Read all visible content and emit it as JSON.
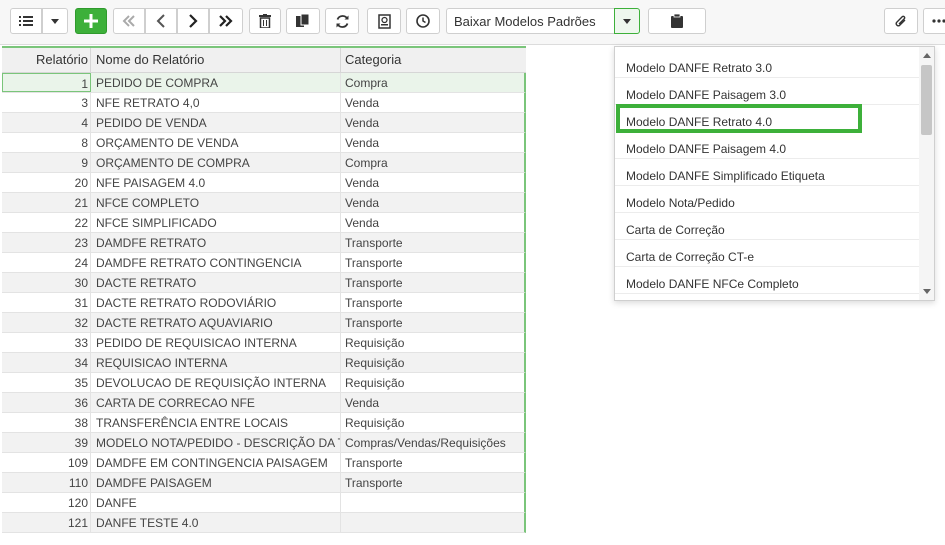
{
  "toolbar": {
    "report_template_combo": "Baixar Modelos Padrões",
    "icons": [
      "list-icon",
      "chevron-down-icon",
      "plus-icon",
      "first-page-icon",
      "previous-icon",
      "next-icon",
      "last-page-icon",
      "trash-icon",
      "copy-icon",
      "refresh-icon",
      "report-icon",
      "clock-icon",
      "chevron-down-icon",
      "clipboard-icon",
      "paperclip-icon",
      "more-icon"
    ]
  },
  "grid": {
    "columns": [
      "Relatório",
      "Nome do Relatório",
      "Categoria"
    ],
    "rows": [
      {
        "id": "1",
        "name": "PEDIDO DE COMPRA",
        "category": "Compra"
      },
      {
        "id": "3",
        "name": "NFE RETRATO 4,0",
        "category": "Venda"
      },
      {
        "id": "4",
        "name": "PEDIDO DE VENDA",
        "category": "Venda"
      },
      {
        "id": "8",
        "name": "ORÇAMENTO DE VENDA",
        "category": "Venda"
      },
      {
        "id": "9",
        "name": "ORÇAMENTO DE COMPRA",
        "category": "Compra"
      },
      {
        "id": "20",
        "name": "NFE PAISAGEM 4.0",
        "category": "Venda"
      },
      {
        "id": "21",
        "name": "NFCE COMPLETO",
        "category": "Venda"
      },
      {
        "id": "22",
        "name": "NFCE SIMPLIFICADO",
        "category": "Venda"
      },
      {
        "id": "23",
        "name": "DAMDFE RETRATO",
        "category": "Transporte"
      },
      {
        "id": "24",
        "name": "DAMDFE RETRATO CONTINGENCIA",
        "category": "Transporte"
      },
      {
        "id": "30",
        "name": "DACTE RETRATO",
        "category": "Transporte"
      },
      {
        "id": "31",
        "name": "DACTE RETRATO RODOVIÁRIO",
        "category": "Transporte"
      },
      {
        "id": "32",
        "name": "DACTE RETRATO AQUAVIARIO",
        "category": "Transporte"
      },
      {
        "id": "33",
        "name": "PEDIDO DE REQUISICAO INTERNA",
        "category": "Requisição"
      },
      {
        "id": "34",
        "name": "REQUISICAO INTERNA",
        "category": "Requisição"
      },
      {
        "id": "35",
        "name": "DEVOLUCAO DE REQUISIÇÃO INTERNA",
        "category": "Requisição"
      },
      {
        "id": "36",
        "name": "CARTA DE CORRECAO NFE",
        "category": "Venda"
      },
      {
        "id": "38",
        "name": "TRANSFERÊNCIA ENTRE LOCAIS",
        "category": "Requisição"
      },
      {
        "id": "39",
        "name": "MODELO NOTA/PEDIDO - DESCRIÇÃO DA T",
        "category": "Compras/Vendas/Requisições"
      },
      {
        "id": "109",
        "name": "DAMDFE EM CONTINGENCIA PAISAGEM",
        "category": "Transporte"
      },
      {
        "id": "110",
        "name": "DAMDFE PAISAGEM",
        "category": "Transporte"
      },
      {
        "id": "120",
        "name": "DANFE",
        "category": ""
      },
      {
        "id": "121",
        "name": "DANFE TESTE 4.0",
        "category": ""
      }
    ]
  },
  "dropdown": {
    "items": [
      "Modelo DANFE Retrato 3.0",
      "Modelo DANFE Paisagem 3.0",
      "Modelo DANFE Retrato 4.0",
      "Modelo DANFE Paisagem 4.0",
      "Modelo DANFE Simplificado Etiqueta",
      "Modelo Nota/Pedido",
      "Carta de Correção",
      "Carta de Correção CT-e",
      "Modelo DANFE NFCe Completo"
    ],
    "highlighted": "Modelo DANFE Retrato 4.0",
    "highlight_color": "#3db03a"
  }
}
